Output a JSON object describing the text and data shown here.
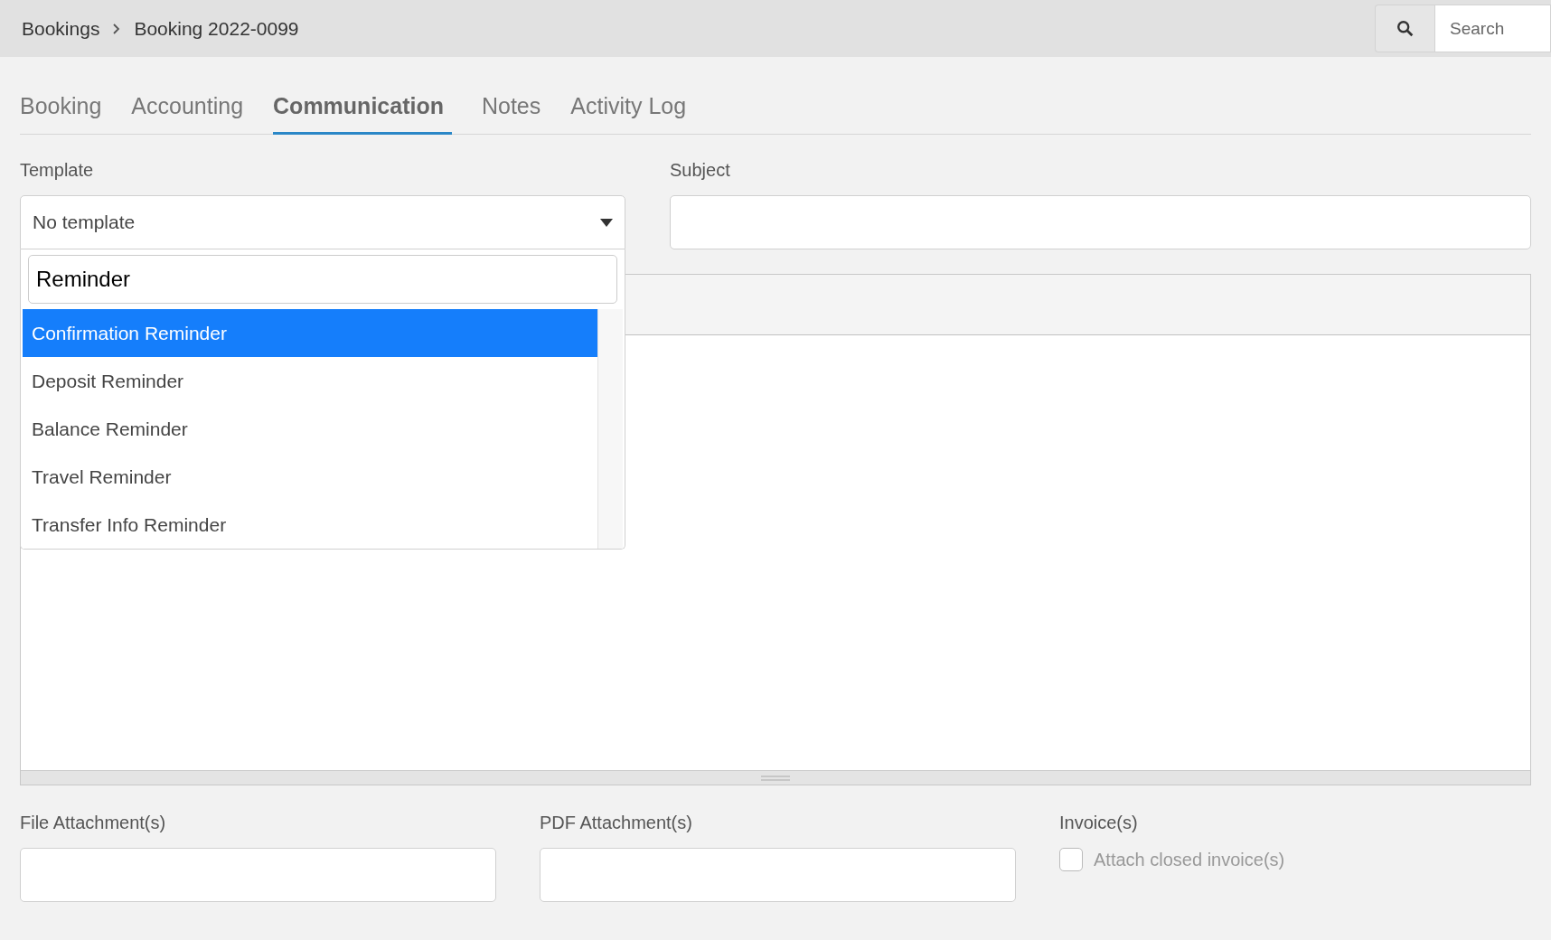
{
  "breadcrumb": [
    "Bookings",
    "Booking 2022-0099"
  ],
  "search": {
    "placeholder": "Search"
  },
  "tabs": [
    {
      "label": "Booking",
      "selected": false
    },
    {
      "label": "Accounting",
      "selected": false
    },
    {
      "label": "Communication",
      "selected": true
    },
    {
      "label": "Notes",
      "selected": false
    },
    {
      "label": "Activity Log",
      "selected": false
    }
  ],
  "template": {
    "label": "Template",
    "value": "No template",
    "expanded": true,
    "filter": "Reminder",
    "options": [
      {
        "label": "Confirmation Reminder",
        "selected": true
      },
      {
        "label": "Deposit Reminder",
        "selected": false
      },
      {
        "label": "Balance Reminder",
        "selected": false
      },
      {
        "label": "Travel Reminder",
        "selected": false
      },
      {
        "label": "Transfer Info Reminder",
        "selected": false
      }
    ]
  },
  "subject": {
    "label": "Subject"
  },
  "attachments": [
    {
      "label": "File Attachment(s)"
    },
    {
      "label": "PDF Attachment(s)"
    }
  ],
  "invoices": {
    "label": "Invoice(s)",
    "checkbox": {
      "label": "Attach closed invoice(s)",
      "checked": false
    }
  }
}
